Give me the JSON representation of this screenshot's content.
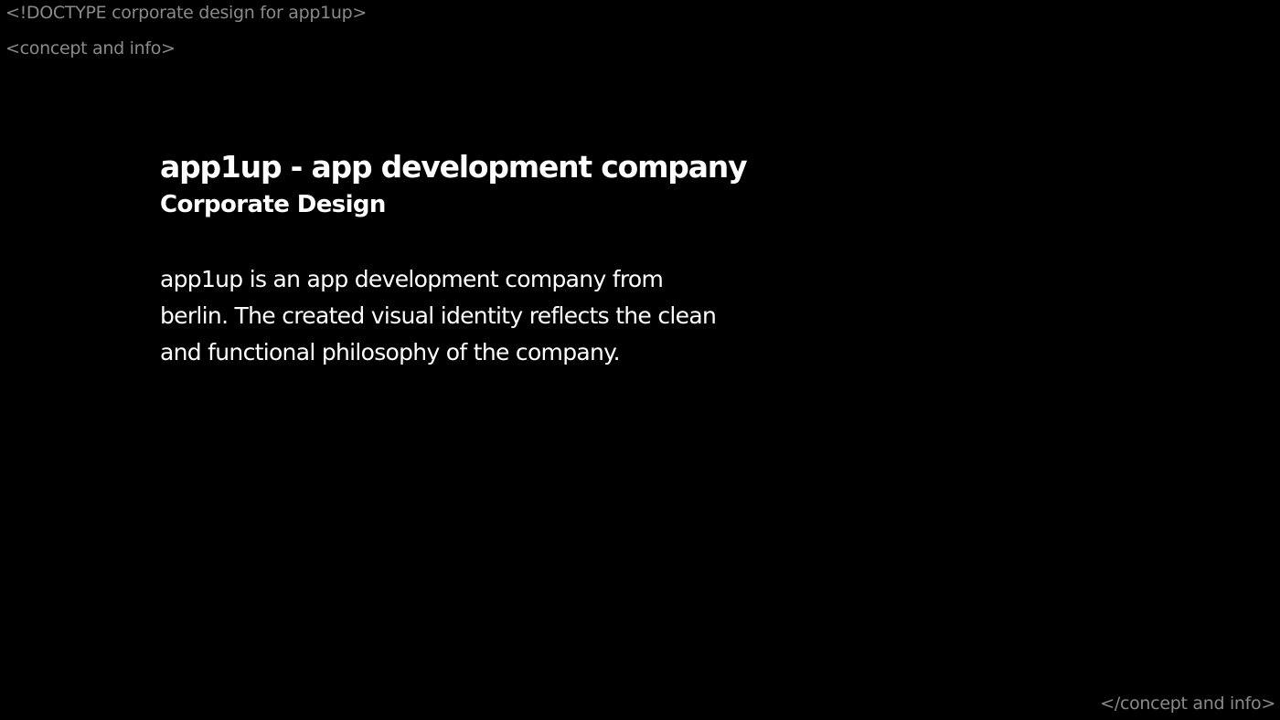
{
  "tags": {
    "doctype": "<!DOCTYPE corporate design for app1up>",
    "concept_open": "<concept and info>",
    "concept_close": "</concept and info>"
  },
  "main": {
    "title": "app1up - app development company",
    "subtitle": "Corporate Design",
    "description": "app1up is an app development company from berlin. The created visual identity reflects the clean and functional philosophy of the company."
  },
  "colors": {
    "background": "#000000",
    "text": "#ffffff",
    "tag_text": "#8a8a8a"
  }
}
